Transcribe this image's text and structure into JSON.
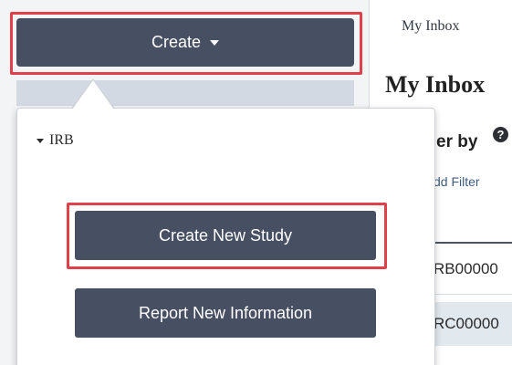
{
  "create_menu": {
    "button_label": "Create",
    "section_label": "IRB",
    "items": [
      {
        "label": "Create New Study"
      },
      {
        "label": "Report New Information"
      }
    ]
  },
  "inbox": {
    "breadcrumb": "My Inbox",
    "title": "My Inbox",
    "filter_label": "er by",
    "add_filter_label": "dd Filter",
    "column_header": "",
    "rows": [
      {
        "id": "RB00000"
      },
      {
        "id": "RC00000"
      }
    ]
  },
  "colors": {
    "button_bg": "#474f63",
    "highlight": "#e0404a",
    "link": "#3e5d7e",
    "row_alt": "#e1e9ef"
  }
}
